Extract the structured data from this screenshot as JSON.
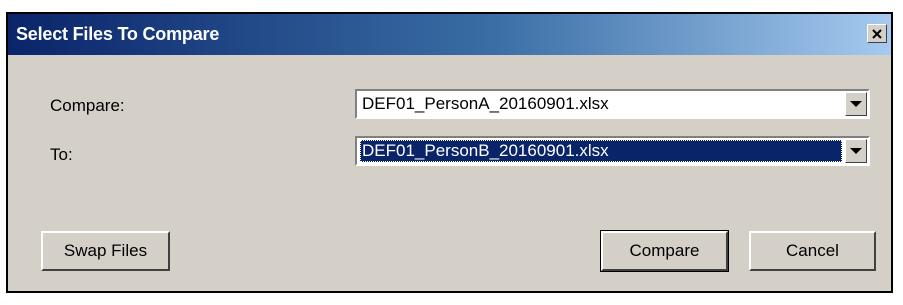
{
  "dialog": {
    "title": "Select Files To Compare",
    "close_icon": "close-icon"
  },
  "form": {
    "compare_label": "Compare:",
    "compare_value": "DEF01_PersonA_20160901.xlsx",
    "to_label": "To:",
    "to_value": "DEF01_PersonB_20160901.xlsx"
  },
  "buttons": {
    "swap": "Swap Files",
    "compare": "Compare",
    "cancel": "Cancel"
  },
  "colors": {
    "title_bar_start": "#0a246a",
    "title_bar_end": "#a6caf0",
    "dialog_bg": "#d4d0c8",
    "selection": "#0a246a"
  }
}
